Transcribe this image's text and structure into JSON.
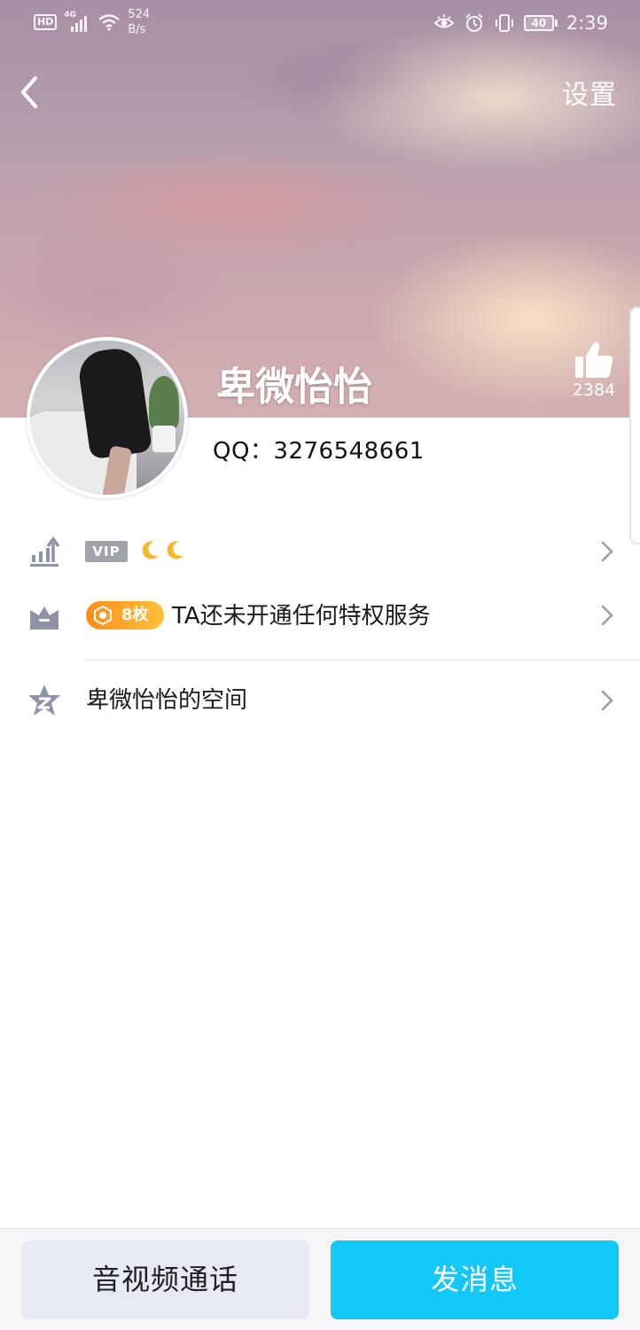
{
  "status_bar": {
    "hd_label": "HD",
    "network_type": "4G",
    "net_speed_value": "524",
    "net_speed_unit": "B/s",
    "battery_level": "40",
    "time": "2:39"
  },
  "nav": {
    "settings_label": "设置"
  },
  "profile": {
    "nickname": "卑微怡怡",
    "qq_line": "QQ：3276548661",
    "like_count": "2384"
  },
  "rows": {
    "vip_label": "VIP",
    "medal_count": "8枚",
    "privilege_text": "TA还未开通任何特权服务",
    "space_text": "卑微怡怡的空间"
  },
  "actions": {
    "call_label": "音视频通话",
    "message_label": "发消息"
  },
  "colors": {
    "accent": "#12c8f7",
    "medal_gradient_start": "#ff8c1a",
    "medal_gradient_end": "#ffc23a",
    "icon_gray": "#8e93a8"
  },
  "icons": {
    "back": "chevron-left-icon",
    "like": "thumbs-up-icon",
    "level": "level-chart-icon",
    "privilege": "crown-icon",
    "space": "qzone-star-icon",
    "chevron": "chevron-right-icon",
    "moon": "moon-icon"
  }
}
